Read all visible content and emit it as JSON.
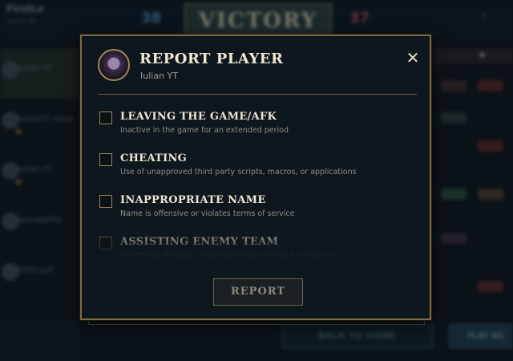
{
  "background": {
    "banner": "VICTORY",
    "score_blue": "38",
    "score_red": "37",
    "brand": "FirstLe",
    "brand_sub": "Level 42",
    "back_button": "BACK TO HOME",
    "play_button": "PLAY AG",
    "players": [
      "Iulian YT",
      "IulianYT clone",
      "Iulian YT",
      "ssmuJarPro",
      "HTPCoaT"
    ]
  },
  "modal": {
    "title": "REPORT PLAYER",
    "player_name": "Iulian YT",
    "close_glyph": "✕",
    "options": [
      {
        "title": "LEAVING THE GAME/AFK",
        "description": "Inactive in the game for an extended period"
      },
      {
        "title": "CHEATING",
        "description": "Use of unapproved third party scripts, macros, or applications"
      },
      {
        "title": "INAPPROPRIATE NAME",
        "description": "Name is offensive or violates terms of service"
      },
      {
        "title": "ASSISTING ENEMY TEAM",
        "description": "Intentional feeding, unsportsmanlike conduct, giving up"
      }
    ],
    "report_label": "REPORT"
  },
  "colors": {
    "gold_border": "#7e6a3e",
    "title_text": "#f0e6d2",
    "panel_bg": "#0f171e"
  }
}
